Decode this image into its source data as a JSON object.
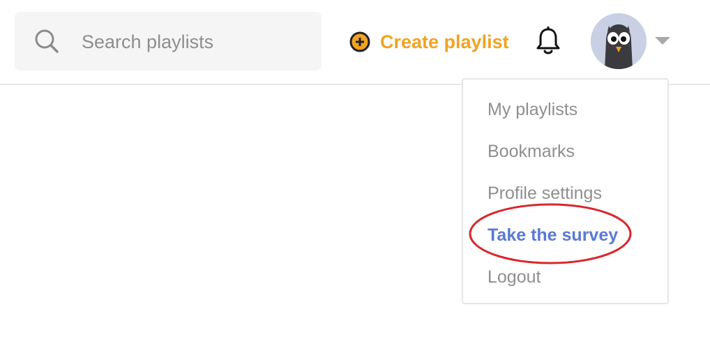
{
  "search": {
    "placeholder": "Search playlists",
    "value": "",
    "icon": "search-icon"
  },
  "header": {
    "create_label": "Create playlist",
    "create_icon": "plus-circle-icon",
    "notification_icon": "bell-icon",
    "avatar_icon": "penguin-avatar",
    "menu_toggle_icon": "caret-down-icon"
  },
  "menu": {
    "items": [
      {
        "label": "My playlists"
      },
      {
        "label": "Bookmarks"
      },
      {
        "label": "Profile settings"
      },
      {
        "label": "Take the survey",
        "highlighted": true
      },
      {
        "label": "Logout"
      }
    ]
  },
  "colors": {
    "accent_orange": "#f0a323",
    "link_blue": "#5a79d4",
    "annotation_red": "#d9262c",
    "muted_text": "#8f8f8f"
  }
}
